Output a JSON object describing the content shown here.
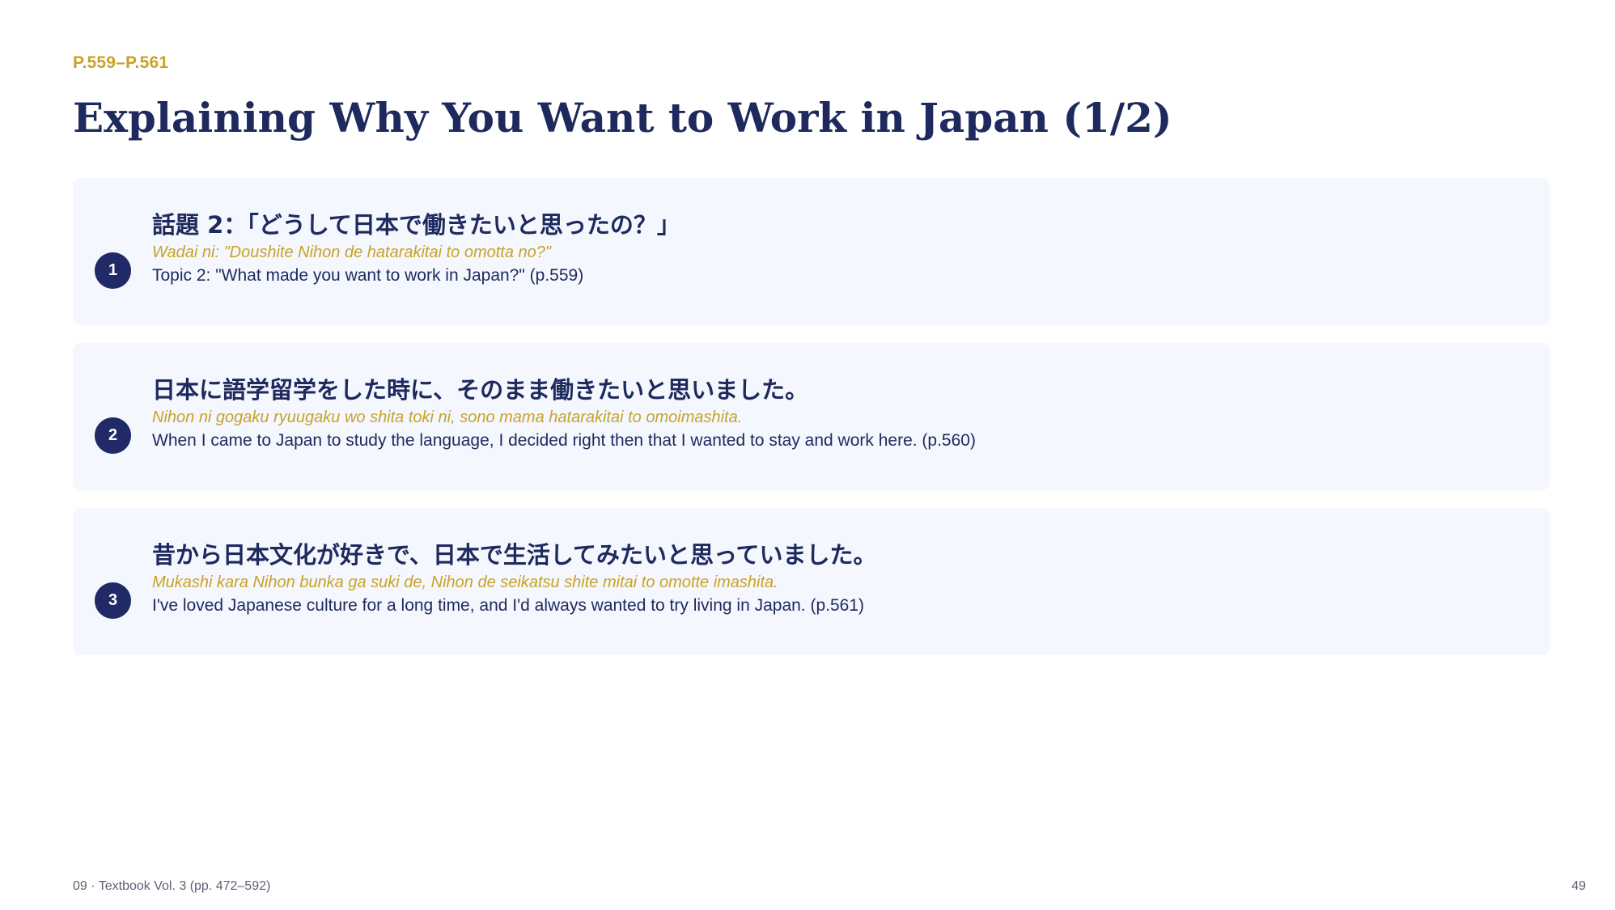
{
  "header": {
    "page_range": "P.559–P.561",
    "title": "Explaining Why You Want to Work in Japan (1/2)"
  },
  "items": [
    {
      "number": "1",
      "japanese": "話題 2：「どうして日本で働きたいと思ったの？」",
      "romaji": "Wadai ni: \"Doushite Nihon de hatarakitai to omotta no?\"",
      "english": "Topic 2: \"What made you want to work in Japan?\" (p.559)"
    },
    {
      "number": "2",
      "japanese": "日本に語学留学をした時に、そのまま働きたいと思いました。",
      "romaji": "Nihon ni gogaku ryuugaku wo shita toki ni, sono mama hatarakitai to omoimashita.",
      "english": "When I came to Japan to study the language, I decided right then that I wanted to stay and work here. (p.560)"
    },
    {
      "number": "3",
      "japanese": "昔から日本文化が好きで、日本で生活してみたいと思っていました。",
      "romaji": "Mukashi kara Nihon bunka ga suki de, Nihon de seikatsu shite mitai to omotte imashita.",
      "english": "I've loved Japanese culture for a long time, and I'd always wanted to try living in Japan. (p.561)"
    }
  ],
  "footer": {
    "left": "09 · Textbook Vol. 3 (pp. 472–592)",
    "right": "49"
  },
  "colors": {
    "navy": "#1e2a5e",
    "gold": "#c9a227",
    "card_bg": "#f4f7fd"
  }
}
